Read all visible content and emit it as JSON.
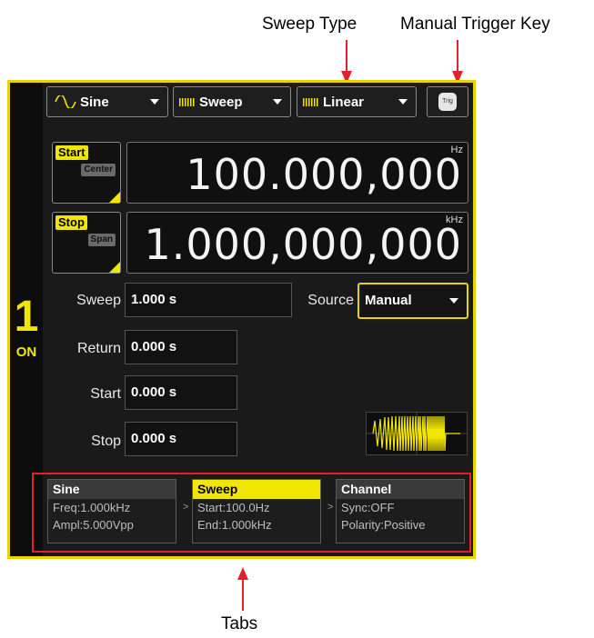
{
  "annotations": {
    "sweep_type": "Sweep Type",
    "manual_trigger_key": "Manual Trigger Key",
    "tabs": "Tabs"
  },
  "channel": {
    "number": "1",
    "state": "ON"
  },
  "toolbar": {
    "waveform": {
      "label": "Sine",
      "icon": "sine-wave-icon"
    },
    "mode": {
      "label": "Sweep",
      "icon": "sweep-icon"
    },
    "sweep_type": {
      "label": "Linear",
      "icon": "linear-sweep-icon"
    },
    "trigger": {
      "label": "Trig",
      "icon": "trig-key-icon"
    }
  },
  "start_box": {
    "tag": "Start",
    "subtag": "Center"
  },
  "stop_box": {
    "tag": "Stop",
    "subtag": "Span"
  },
  "start_value": {
    "value": "100.000,000",
    "unit": "Hz"
  },
  "stop_value": {
    "value": "1.000,000,000",
    "unit": "kHz"
  },
  "params": {
    "sweep": {
      "label": "Sweep",
      "value": "1.000 s"
    },
    "source": {
      "label": "Source",
      "value": "Manual"
    },
    "return": {
      "label": "Return",
      "value": "0.000 s"
    },
    "start": {
      "label": "Start",
      "value": "0.000 s"
    },
    "stop": {
      "label": "Stop",
      "value": "0.000 s"
    }
  },
  "tabs": [
    {
      "title": "Sine",
      "lines": [
        "Freq:1.000kHz",
        "Ampl:5.000Vpp"
      ]
    },
    {
      "title": "Sweep",
      "lines": [
        "Start:100.0Hz",
        "End:1.000kHz"
      ]
    },
    {
      "title": "Channel",
      "lines": [
        "Sync:OFF",
        "Polarity:Positive"
      ]
    }
  ],
  "colors": {
    "accent": "#f2e600",
    "callout": "#e0222a",
    "background": "#1a1a1a"
  }
}
